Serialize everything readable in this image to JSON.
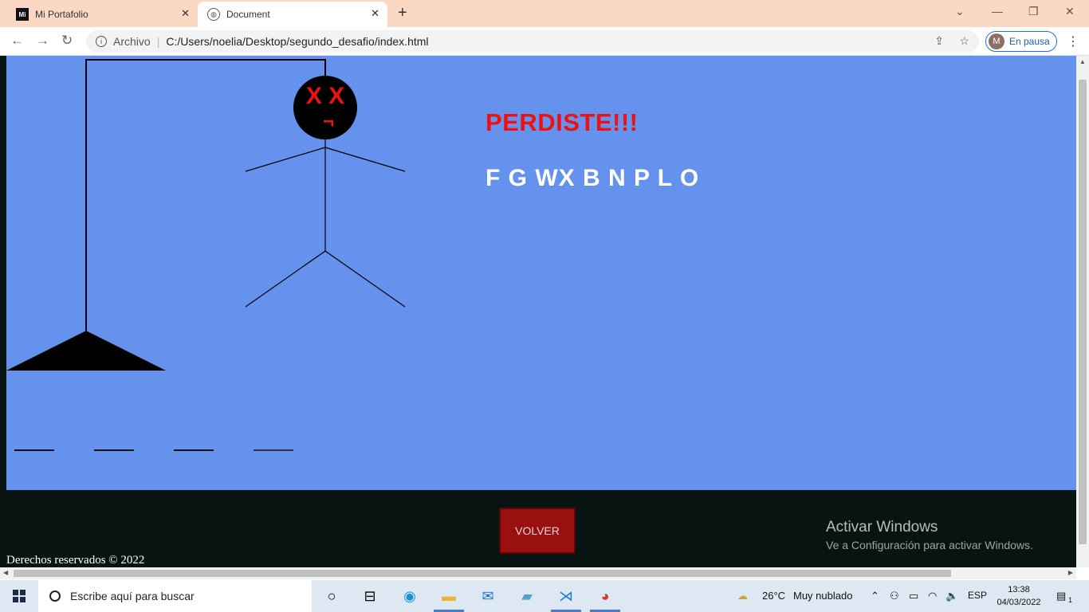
{
  "browser": {
    "tabs": [
      {
        "title": "Mi Portafolio",
        "icon": "portfolio-favicon-icon",
        "active": false
      },
      {
        "title": "Document",
        "icon": "globe-icon",
        "active": true
      }
    ],
    "address": {
      "scheme_label": "Archivo",
      "url": "C:/Users/noelia/Desktop/segundo_desafio/index.html"
    },
    "profile": {
      "initial": "M",
      "status": "En pausa"
    }
  },
  "game": {
    "result": "PERDISTE!!!",
    "wrong_letters": "F G WX B N P L O",
    "face_eyes": "X X",
    "face_mouth": "¬",
    "blank_count": 4,
    "colors": {
      "background": "#6592ec",
      "result": "#ee1111",
      "letters": "#ffffff"
    }
  },
  "footer": {
    "volver_label": "VOLVER",
    "copyright": "Derechos reservados © 2022",
    "colors": {
      "background": "#081412",
      "button": "#9a1010"
    }
  },
  "watermark": {
    "title": "Activar Windows",
    "subtitle": "Ve a Configuración para activar Windows."
  },
  "taskbar": {
    "search_placeholder": "Escribe aquí para buscar",
    "weather_temp": "26°C",
    "weather_desc": "Muy nublado",
    "language": "ESP",
    "time": "13:38",
    "date": "04/03/2022",
    "notification_count": "1"
  }
}
